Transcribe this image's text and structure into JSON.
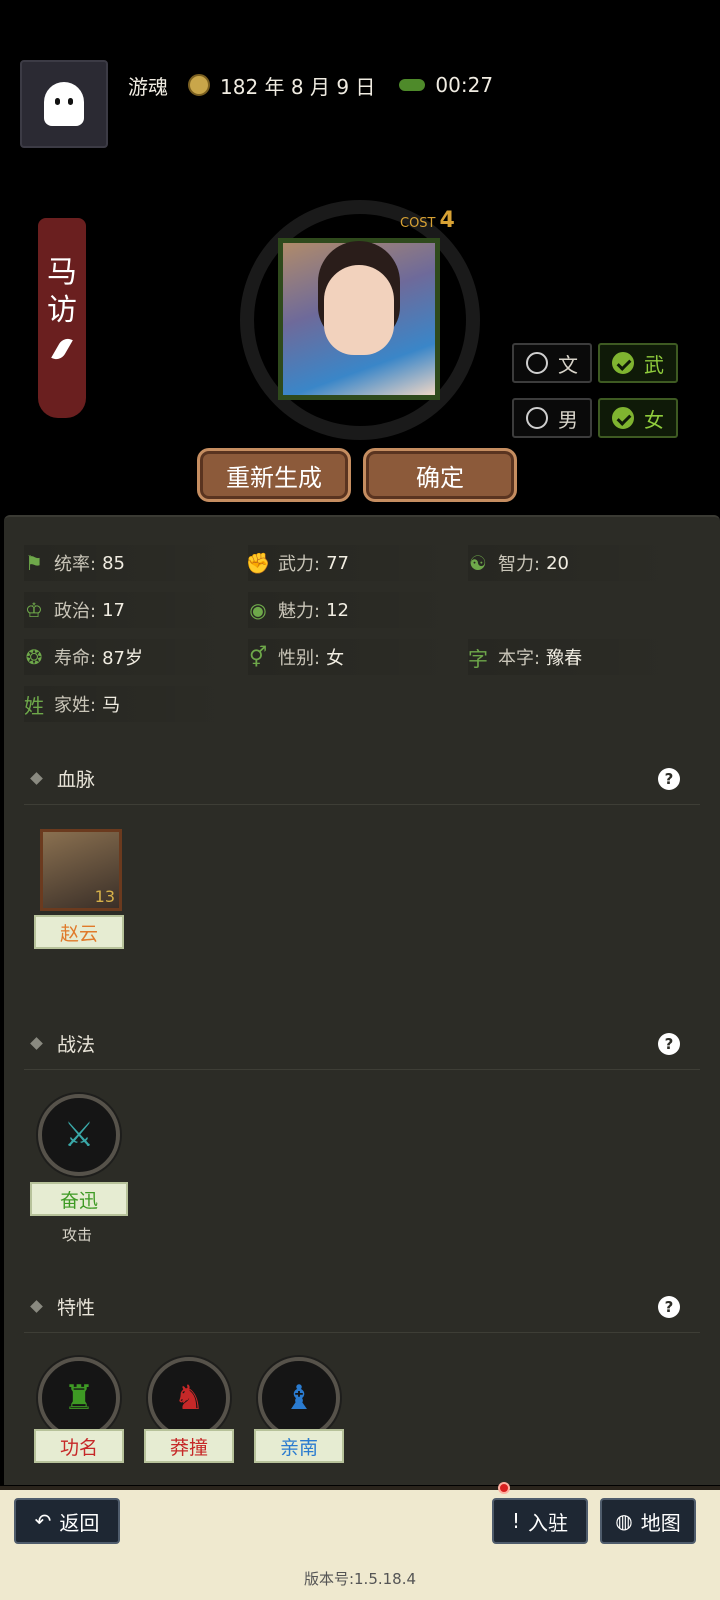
{
  "header": {
    "mode": "游魂",
    "date": "182 年 8 月 9 日",
    "time": "00:27"
  },
  "character": {
    "name_line1": "马",
    "name_line2": "访",
    "cost_label": "COST",
    "cost_value": "4"
  },
  "toggles": {
    "wen": "文",
    "wu": "武",
    "male": "男",
    "female": "女",
    "wu_selected": true,
    "female_selected": true
  },
  "buttons": {
    "regenerate": "重新生成",
    "confirm": "确定"
  },
  "stats": {
    "tongshuai_label": "统率:",
    "tongshuai": "85",
    "wuli_label": "武力:",
    "wuli": "77",
    "zhili_label": "智力:",
    "zhili": "20",
    "zhengzhi_label": "政治:",
    "zhengzhi": "17",
    "meili_label": "魅力:",
    "meili": "12",
    "shouming_label": "寿命:",
    "shouming": "87岁",
    "xingbie_label": "性别:",
    "xingbie": "女",
    "benzi_icon": "字",
    "benzi_label": "本字:",
    "benzi": "豫春",
    "jiaxing_icon": "姓",
    "jiaxing_label": "家姓:",
    "jiaxing": "马"
  },
  "bloodline": {
    "title": "血脉",
    "help": "?",
    "ancestor_name": "赵云",
    "ancestor_level": "13"
  },
  "tactics": {
    "title": "战法",
    "help": "?",
    "skill_name": "奋迅",
    "skill_type": "攻击"
  },
  "traits": {
    "title": "特性",
    "help": "?",
    "items": [
      {
        "name": "功名",
        "color": "#c62828"
      },
      {
        "name": "莽撞",
        "color": "#c62828"
      },
      {
        "name": "亲南",
        "color": "#2a7bd0"
      }
    ]
  },
  "footer": {
    "back": "返回",
    "settle": "入驻",
    "map": "地图",
    "version": "版本号:1.5.18.4"
  }
}
